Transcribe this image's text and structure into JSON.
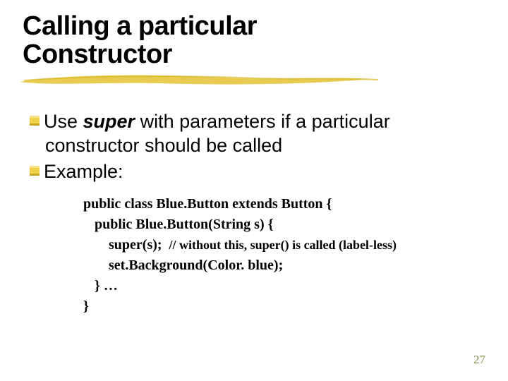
{
  "title_line1": "Calling a particular",
  "title_line2": "Constructor",
  "bullets": {
    "b1_pre": "Use ",
    "b1_kw": "super",
    "b1_post": "  with parameters if a particular",
    "b1_cont": "constructor should be called",
    "b2": "Example:"
  },
  "code": {
    "l1": "public class Blue.Button extends Button {",
    "l2": "public Blue.Button(String s) {",
    "l3a": "super(s);  ",
    "l3b": "// without this, super() is called (label-less)",
    "l4": "set.Background(Color. blue);",
    "l5": "} …",
    "l6": "}"
  },
  "page_number": "27",
  "colors": {
    "highlight": "#e6c73f",
    "bullet": "#f0d24a"
  }
}
